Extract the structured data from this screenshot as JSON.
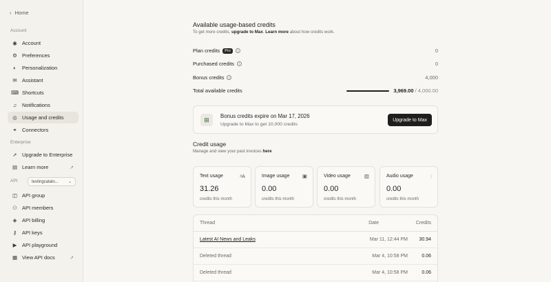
{
  "sidebar": {
    "home": "Home",
    "sections": {
      "account": "Account",
      "enterprise": "Enterprise",
      "api": "API"
    },
    "account_items": [
      {
        "label": "Account",
        "icon": "user-circle-icon"
      },
      {
        "label": "Preferences",
        "icon": "sliders-icon"
      },
      {
        "label": "Personalization",
        "icon": "toggle-icon"
      },
      {
        "label": "Assistant",
        "icon": "envelope-icon"
      },
      {
        "label": "Shortcuts",
        "icon": "keyboard-icon"
      },
      {
        "label": "Notifications",
        "icon": "bell-icon"
      },
      {
        "label": "Usage and credits",
        "icon": "coins-icon"
      },
      {
        "label": "Connectors",
        "icon": "connector-icon"
      }
    ],
    "enterprise_items": [
      {
        "label": "Upgrade to Enterprise",
        "icon": "rocket-icon"
      },
      {
        "label": "Learn more",
        "icon": "book-icon"
      }
    ],
    "api_select": "testingcatalo...",
    "api_items": [
      {
        "label": "API group",
        "icon": "group-icon"
      },
      {
        "label": "API members",
        "icon": "members-icon"
      },
      {
        "label": "API billing",
        "icon": "billing-icon"
      },
      {
        "label": "API keys",
        "icon": "key-icon"
      },
      {
        "label": "API playground",
        "icon": "playground-icon"
      },
      {
        "label": "View API docs",
        "icon": "docs-icon"
      }
    ]
  },
  "credits": {
    "title": "Available usage-based credits",
    "subtitle_pre": "To get more credits, ",
    "subtitle_link": "upgrade to Max",
    "subtitle_mid": ". ",
    "subtitle_link2": "Learn more",
    "subtitle_post": " about how credits work.",
    "plan_label": "Plan credits",
    "plan_badge": "Pro",
    "plan_value": "0",
    "purchased_label": "Purchased credits",
    "purchased_value": "0",
    "bonus_label": "Bonus credits",
    "bonus_value": "4,000",
    "total_label": "Total available credits",
    "total_value": "3,969.00",
    "total_max": "/ 4,000.00",
    "total_fraction": 0.992
  },
  "banner": {
    "title": "Bonus credits expire on Mar 17, 2026",
    "subtitle": "Upgrade to Max to get 10,000 credits",
    "button": "Upgrade to Max"
  },
  "usage": {
    "title": "Credit usage",
    "subtitle_pre": "Manage and view your past invoices ",
    "subtitle_link": "here",
    "cards": [
      {
        "title": "Text usage",
        "value": "31.26",
        "sub": "credits this month",
        "icon": "text-icon"
      },
      {
        "title": "Image usage",
        "value": "0.00",
        "sub": "credits this month",
        "icon": "image-icon"
      },
      {
        "title": "Video usage",
        "value": "0.00",
        "sub": "credits this month",
        "icon": "video-icon"
      },
      {
        "title": "Audio usage",
        "value": "0.00",
        "sub": "credits this month",
        "icon": "audio-wave-icon"
      }
    ]
  },
  "table": {
    "headers": {
      "thread": "Thread",
      "date": "Date",
      "credits": "Credits"
    },
    "rows": [
      {
        "thread": "Latest AI News and Leaks",
        "date": "Mar 11, 12:44 PM",
        "credits": "30.94"
      },
      {
        "thread": "Deleted thread",
        "date": "Mar 4, 10:58 PM",
        "credits": "0.06"
      },
      {
        "thread": "Deleted thread",
        "date": "Mar 4, 10:58 PM",
        "credits": "0.06"
      }
    ]
  }
}
